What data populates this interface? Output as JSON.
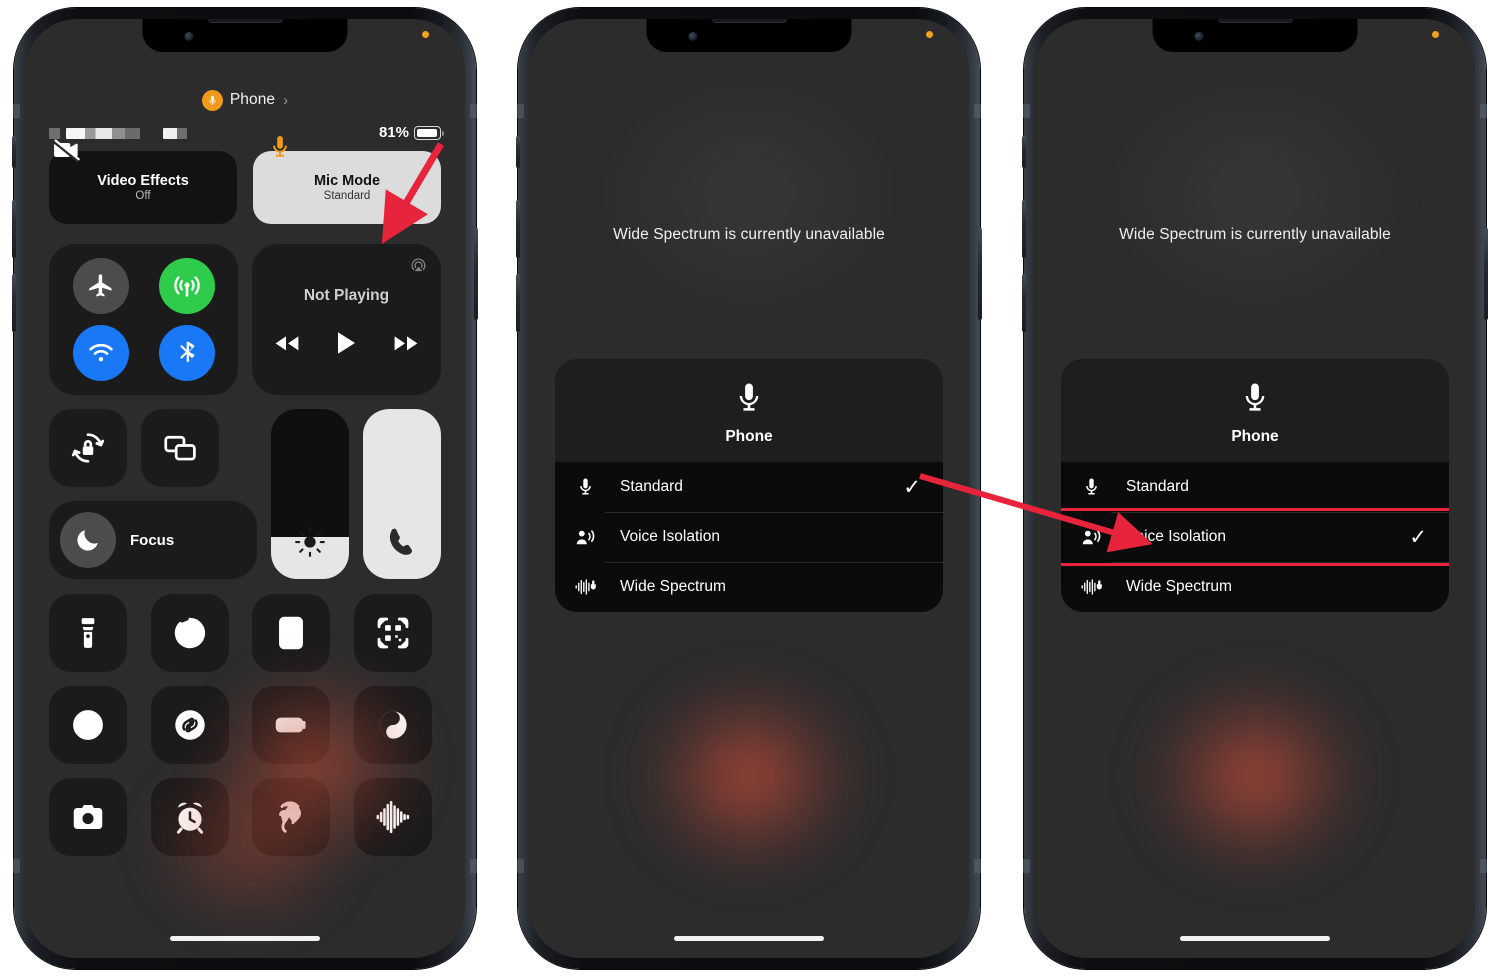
{
  "phone1": {
    "header": {
      "label": "Phone",
      "chevron": "›",
      "icon": "microphone-icon"
    },
    "status": {
      "battery_percent": "81%"
    },
    "video_effects": {
      "title": "Video Effects",
      "subtitle": "Off",
      "icon": "video-off-icon"
    },
    "mic_mode": {
      "title": "Mic Mode",
      "subtitle": "Standard",
      "icon": "microphone-icon"
    },
    "connectivity": [
      {
        "name": "airplane-mode-toggle",
        "icon": "airplane-icon",
        "state": "off",
        "color": "#4c4c4e"
      },
      {
        "name": "cellular-data-toggle",
        "icon": "cellular-icon",
        "state": "on",
        "color": "#2ecc4a"
      },
      {
        "name": "wifi-toggle",
        "icon": "wifi-icon",
        "state": "on",
        "color": "#1878f5"
      },
      {
        "name": "bluetooth-toggle",
        "icon": "bluetooth-icon",
        "state": "on",
        "color": "#1878f5"
      }
    ],
    "now_playing": {
      "title": "Not Playing",
      "airplay": "airplay-icon",
      "prev": "rewind-icon",
      "play": "play-icon",
      "next": "fast-forward-icon"
    },
    "rotation_lock": {
      "icon": "rotation-lock-icon"
    },
    "screen_mirroring": {
      "icon": "screen-mirroring-icon"
    },
    "focus": {
      "label": "Focus",
      "icon": "moon-icon"
    },
    "brightness": {
      "icon": "brightness-icon",
      "level": 25
    },
    "volume": {
      "icon": "phone-handset-icon",
      "level": 100
    },
    "shortcuts": [
      {
        "name": "flashlight-tile",
        "icon": "flashlight-icon"
      },
      {
        "name": "timer-tile",
        "icon": "timer-icon"
      },
      {
        "name": "calculator-tile",
        "icon": "calculator-icon"
      },
      {
        "name": "qr-code-scanner-tile",
        "icon": "qr-code-icon"
      },
      {
        "name": "screen-recording-tile",
        "icon": "record-icon"
      },
      {
        "name": "shazam-tile",
        "icon": "shazam-icon"
      },
      {
        "name": "low-power-mode-tile",
        "icon": "battery-low-power-icon"
      },
      {
        "name": "dark-mode-tile",
        "icon": "dark-mode-icon"
      },
      {
        "name": "camera-tile",
        "icon": "camera-icon"
      },
      {
        "name": "alarm-tile",
        "icon": "alarm-clock-icon"
      },
      {
        "name": "hearing-tile",
        "icon": "ear-icon"
      },
      {
        "name": "sound-recognition-tile",
        "icon": "waveform-icon"
      }
    ]
  },
  "phone2": {
    "notice": "Wide Spectrum is currently unavailable",
    "sheet": {
      "title": "Phone",
      "icon": "microphone-icon",
      "options": [
        {
          "label": "Standard",
          "icon": "microphone-icon",
          "selected": true
        },
        {
          "label": "Voice Isolation",
          "icon": "voice-isolation-icon",
          "selected": false
        },
        {
          "label": "Wide Spectrum",
          "icon": "wide-spectrum-icon",
          "selected": false
        }
      ]
    }
  },
  "phone3": {
    "notice": "Wide Spectrum is currently unavailable",
    "sheet": {
      "title": "Phone",
      "icon": "microphone-icon",
      "options": [
        {
          "label": "Standard",
          "icon": "microphone-icon",
          "selected": false
        },
        {
          "label": "Voice Isolation",
          "icon": "voice-isolation-icon",
          "selected": true,
          "highlighted": true
        },
        {
          "label": "Wide Spectrum",
          "icon": "wide-spectrum-icon",
          "selected": false
        }
      ]
    }
  },
  "annotations": {
    "accent_color": "#e8243c",
    "arrow_1": "points-to-mic-mode-button",
    "arrow_2": "points-to-voice-isolation-option"
  }
}
